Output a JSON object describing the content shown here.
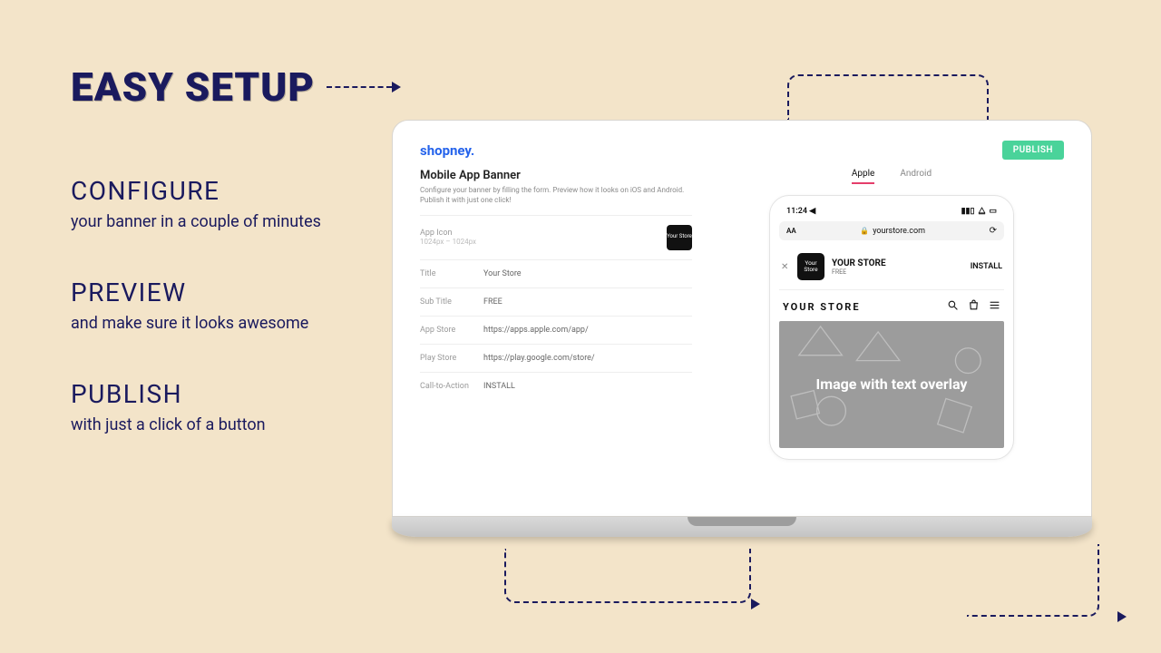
{
  "hero": "EASY SETUP",
  "steps": [
    {
      "title": "CONFIGURE",
      "desc": "your banner in a couple of minutes"
    },
    {
      "title": "PREVIEW",
      "desc": "and make sure it looks awesome"
    },
    {
      "title": "PUBLISH",
      "desc": "with just a click of a button"
    }
  ],
  "app": {
    "brand": "shopney.",
    "publish_label": "PUBLISH",
    "config": {
      "title": "Mobile App Banner",
      "hint": "Configure your banner by filling the form. Preview how it looks on iOS and Android. Publish it with just one click!",
      "app_icon_label": "App Icon",
      "app_icon_hint": "1024px – 1024px",
      "app_icon_text": "Your Store",
      "rows": [
        {
          "label": "Title",
          "value": "Your Store"
        },
        {
          "label": "Sub Title",
          "value": "FREE"
        },
        {
          "label": "App Store",
          "value": "https://apps.apple.com/app/"
        },
        {
          "label": "Play Store",
          "value": "https://play.google.com/store/"
        },
        {
          "label": "Call-to-Action",
          "value": "INSTALL"
        }
      ]
    },
    "preview": {
      "tabs": {
        "apple": "Apple",
        "android": "Android"
      },
      "status_time": "11:24 ◀",
      "url": "yourstore.com",
      "banner_title": "YOUR STORE",
      "banner_sub": "FREE",
      "banner_icon_text": "Your Store",
      "banner_cta": "INSTALL",
      "store_name": "YOUR STORE",
      "hero_text": "Image with text overlay"
    }
  }
}
